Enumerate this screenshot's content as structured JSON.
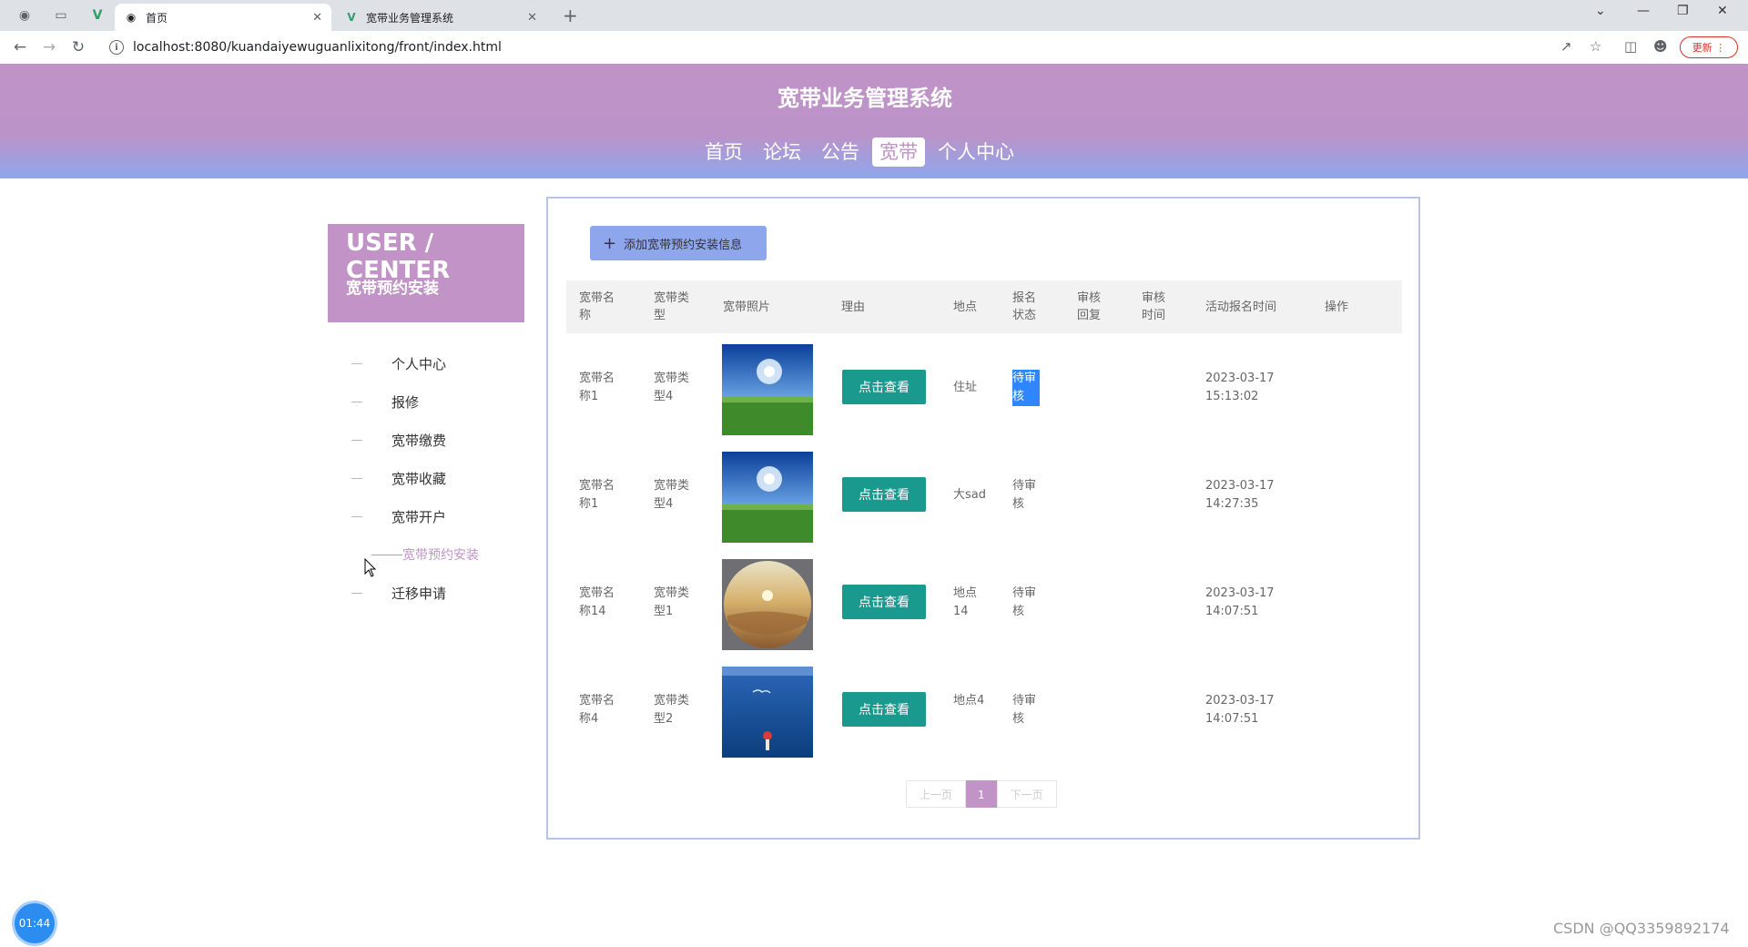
{
  "browser": {
    "tabs": [
      {
        "title": "首页",
        "active": true
      },
      {
        "title": "宽带业务管理系统",
        "active": false
      }
    ],
    "url": "localhost:8080/kuandaiyewuguanlixitong/front/index.html",
    "update_label": "更新"
  },
  "site": {
    "title": "宽带业务管理系统",
    "nav": [
      "首页",
      "论坛",
      "公告",
      "宽带",
      "个人中心"
    ],
    "nav_active": "宽带"
  },
  "sidebar": {
    "title": "USER / CENTER",
    "subtitle": "宽带预约安装",
    "items": [
      "个人中心",
      "报修",
      "宽带缴费",
      "宽带收藏",
      "宽带开户",
      "宽带预约安装",
      "迁移申请"
    ],
    "active_item": "宽带预约安装"
  },
  "panel": {
    "add_button": "添加宽带预约安装信息",
    "columns": [
      "宽带名称",
      "宽带类型",
      "宽带照片",
      "理由",
      "地点",
      "报名状态",
      "审核回复",
      "审核时间",
      "活动报名时间",
      "操作"
    ],
    "view_label": "点击查看",
    "rows": [
      {
        "name": "宽带名称1",
        "type": "宽带类型4",
        "photo": "sky-field",
        "location": "住址",
        "status": "待审核",
        "reply": "",
        "audit_time": "",
        "date": "2023-03-17",
        "time": "15:13:02",
        "status_selected": true
      },
      {
        "name": "宽带名称1",
        "type": "宽带类型4",
        "photo": "sky-field",
        "location": "大sad",
        "status": "待审核",
        "reply": "",
        "audit_time": "",
        "date": "2023-03-17",
        "time": "14:27:35",
        "status_selected": false
      },
      {
        "name": "宽带名称14",
        "type": "宽带类型1",
        "photo": "desert-sunset",
        "location": "地点14",
        "status": "待审核",
        "reply": "",
        "audit_time": "",
        "date": "2023-03-17",
        "time": "14:07:51",
        "status_selected": false
      },
      {
        "name": "宽带名称4",
        "type": "宽带类型2",
        "photo": "sea-figure",
        "location": "地点4",
        "status": "待审核",
        "reply": "",
        "audit_time": "",
        "date": "2023-03-17",
        "time": "14:07:51",
        "status_selected": false
      }
    ],
    "pager": {
      "prev": "上一页",
      "current": "1",
      "next": "下一页"
    }
  },
  "timer": "01:44",
  "watermark": "CSDN @QQ3359892174",
  "colors": {
    "theme": "#c193c7",
    "accent_blue": "#8ea7ec",
    "button_teal": "#1a9a8e"
  }
}
